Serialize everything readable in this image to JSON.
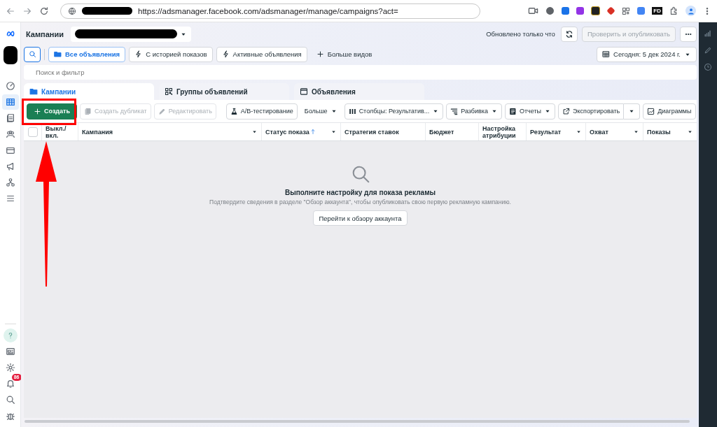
{
  "browser": {
    "url": "https://adsmanager.facebook.com/adsmanager/manage/campaigns?act=",
    "extension_label": "FD"
  },
  "left_nav": [
    {
      "kind": "gauge",
      "selected": false
    },
    {
      "kind": "table",
      "selected": true
    },
    {
      "kind": "pages",
      "selected": false
    },
    {
      "kind": "people",
      "selected": false
    },
    {
      "kind": "card",
      "selected": false
    },
    {
      "kind": "megaphone",
      "selected": false
    },
    {
      "kind": "network",
      "selected": false
    },
    {
      "kind": "menu",
      "selected": false
    }
  ],
  "left_nav_bottom": [
    {
      "kind": "help"
    },
    {
      "kind": "news"
    },
    {
      "kind": "gear"
    },
    {
      "kind": "bell",
      "badge": "86"
    },
    {
      "kind": "search"
    },
    {
      "kind": "bug"
    }
  ],
  "header": {
    "title": "Кампании",
    "status": "Обновлено только что",
    "publish_button": "Проверить и опубликовать",
    "publish_disabled": true
  },
  "views": [
    {
      "label": "Все объявления",
      "kind": "folder",
      "selected": true
    },
    {
      "label": "С историей показов",
      "kind": "bolt",
      "selected": false
    },
    {
      "label": "Активные объявления",
      "kind": "bolt",
      "selected": false
    },
    {
      "label": "Больше видов",
      "kind": "plus",
      "selected": false
    }
  ],
  "date_button": "Сегодня: 5 дек 2024 г.",
  "search": {
    "placeholder": "Поиск и фильтр"
  },
  "level_tabs": [
    {
      "label": "Кампании",
      "kind": "folder",
      "selected": true
    },
    {
      "label": "Группы объявлений",
      "kind": "grid",
      "selected": false
    },
    {
      "label": "Объявления",
      "kind": "window",
      "selected": false
    }
  ],
  "toolbar": [
    {
      "label": "Создать",
      "kind": "plus",
      "primary": true,
      "disabled": false,
      "caret": false
    },
    {
      "label": "Создать дубликат",
      "kind": "copy",
      "primary": false,
      "disabled": true,
      "caret": false
    },
    {
      "label": "Редактировать",
      "kind": "pencil",
      "primary": false,
      "disabled": true,
      "caret": false
    },
    {
      "label": "A/B-тестирование",
      "kind": "flask",
      "primary": false,
      "disabled": false,
      "caret": false
    },
    {
      "label": "Больше",
      "kind": "plain",
      "primary": false,
      "disabled": false,
      "caret": true
    },
    {
      "label": "Столбцы: Результатив...",
      "kind": "columns",
      "primary": false,
      "disabled": false,
      "caret": true
    },
    {
      "label": "Разбивка",
      "kind": "breakdown",
      "primary": false,
      "disabled": false,
      "caret": true
    },
    {
      "label": "Отчеты",
      "kind": "reports",
      "primary": false,
      "disabled": false,
      "caret": true
    },
    {
      "label": "Экспортировать",
      "kind": "export",
      "primary": false,
      "disabled": false,
      "caret": false,
      "split": true
    },
    {
      "label": "Диаграммы",
      "kind": "chart",
      "primary": false,
      "disabled": false,
      "caret": false
    }
  ],
  "table": {
    "columns": [
      {
        "label": "Выкл./ вкл.",
        "sorted": false,
        "menu": false
      },
      {
        "label": "Кампания",
        "sorted": false,
        "menu": true
      },
      {
        "label": "Статус показа",
        "sorted": true,
        "menu": true
      },
      {
        "label": "Стратегия ставок",
        "sorted": false,
        "menu": false
      },
      {
        "label": "Бюджет",
        "sorted": false,
        "menu": false
      },
      {
        "label": "Настройка атрибуции",
        "sorted": false,
        "menu": false
      },
      {
        "label": "Результат",
        "sorted": false,
        "menu": true
      },
      {
        "label": "Охват",
        "sorted": false,
        "menu": true
      },
      {
        "label": "Показы",
        "sorted": false,
        "menu": true
      }
    ],
    "select_all_checked": false
  },
  "empty_state": {
    "title": "Выполните настройку для показа рекламы",
    "message": "Подтвердите сведения в разделе \"Обзор аккаунта\", чтобы опубликовать свою первую рекламную кампанию.",
    "button": "Перейти к обзору аккаунта"
  },
  "annotations": {
    "highlight_box": {
      "color": "#ff0000"
    },
    "arrow": {
      "color": "#ff0000"
    }
  }
}
